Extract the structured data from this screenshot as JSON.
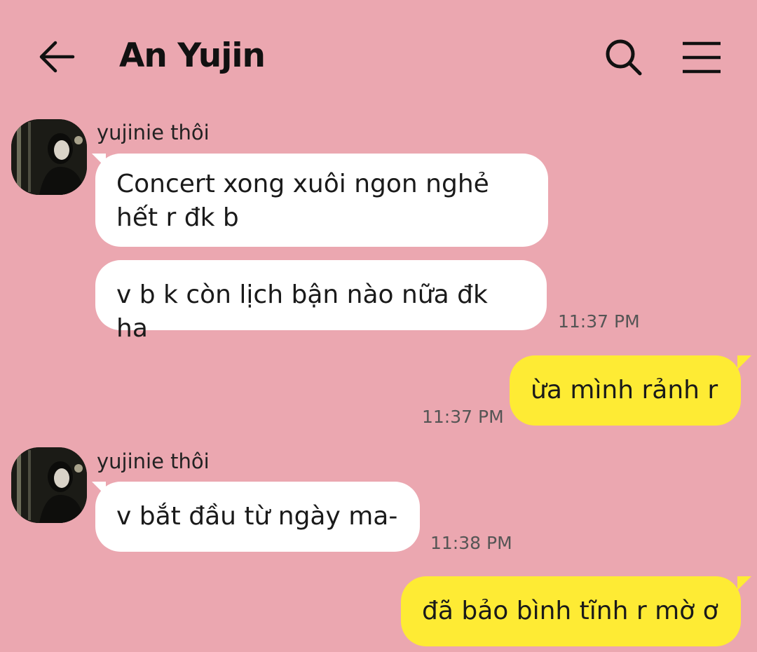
{
  "header": {
    "title": "An Yujin",
    "back_icon": "arrow-left-icon",
    "search_icon": "search-icon",
    "menu_icon": "hamburger-menu-icon"
  },
  "colors": {
    "background": "#EBA7B0",
    "incoming_bubble": "#FFFFFF",
    "outgoing_bubble": "#FEEB34"
  },
  "messages": [
    {
      "direction": "incoming",
      "sender": "yujinie thôi",
      "text": "Concert xong xuôi ngon nghẻ\nhết r đk b"
    },
    {
      "direction": "incoming",
      "text": "v b k còn lịch bận nào nữa đk ha",
      "time": "11:37 PM"
    },
    {
      "direction": "outgoing",
      "text": "ừa mình rảnh r",
      "time": "11:37 PM"
    },
    {
      "direction": "incoming",
      "sender": "yujinie thôi",
      "text": "v bắt đầu từ ngày ma-",
      "time": "11:38 PM"
    },
    {
      "direction": "outgoing",
      "text": "đã bảo bình tĩnh r mờ ơ"
    }
  ]
}
